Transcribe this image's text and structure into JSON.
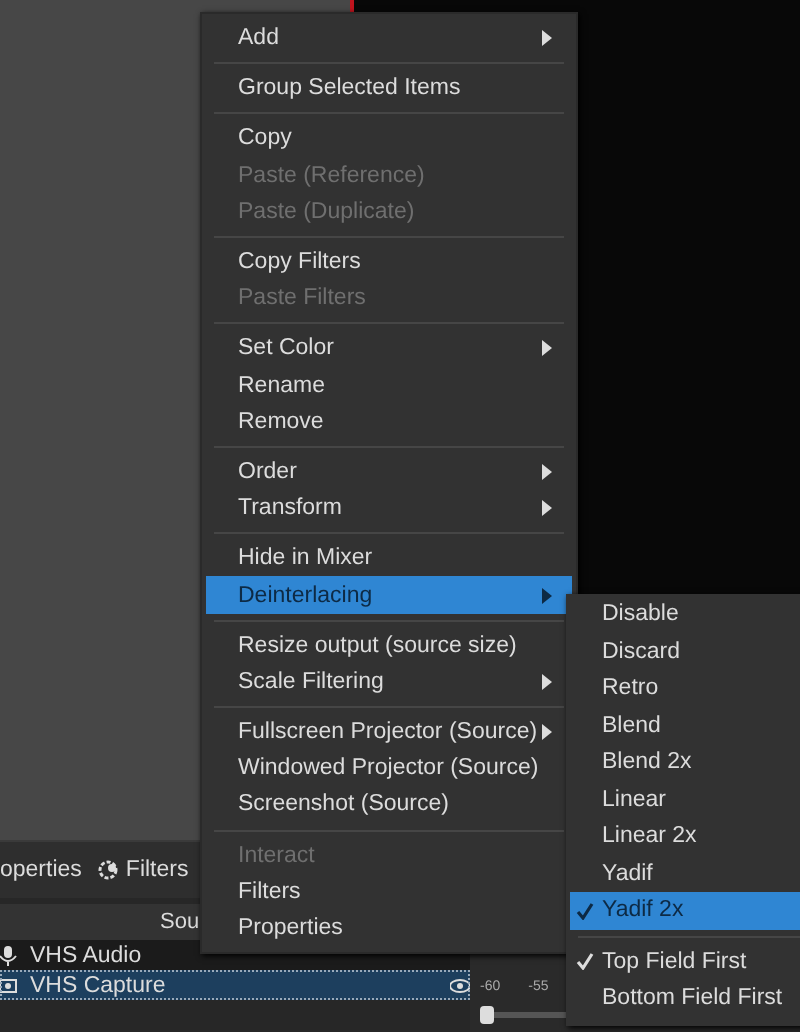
{
  "dock_toolbar": {
    "properties_label": "operties",
    "filters_label": "Filters"
  },
  "sources": {
    "header": "Sou",
    "rows": [
      {
        "name": "VHS Audio",
        "kind": "audio",
        "selected": false
      },
      {
        "name": "VHS Capture",
        "kind": "video",
        "selected": true
      }
    ]
  },
  "mixer": {
    "ticks": [
      "-60",
      "-55"
    ],
    "level": 0.12
  },
  "context_menu": {
    "items": [
      {
        "kind": "item",
        "label": "Add",
        "disabled": false,
        "submenu": true,
        "highlighted": false
      },
      {
        "kind": "separator"
      },
      {
        "kind": "item",
        "label": "Group Selected Items",
        "disabled": false,
        "submenu": false,
        "highlighted": false
      },
      {
        "kind": "separator"
      },
      {
        "kind": "item",
        "label": "Copy",
        "disabled": false,
        "submenu": false,
        "highlighted": false
      },
      {
        "kind": "item",
        "label": "Paste (Reference)",
        "disabled": true,
        "submenu": false,
        "highlighted": false
      },
      {
        "kind": "item",
        "label": "Paste (Duplicate)",
        "disabled": true,
        "submenu": false,
        "highlighted": false
      },
      {
        "kind": "separator"
      },
      {
        "kind": "item",
        "label": "Copy Filters",
        "disabled": false,
        "submenu": false,
        "highlighted": false
      },
      {
        "kind": "item",
        "label": "Paste Filters",
        "disabled": true,
        "submenu": false,
        "highlighted": false
      },
      {
        "kind": "separator"
      },
      {
        "kind": "item",
        "label": "Set Color",
        "disabled": false,
        "submenu": true,
        "highlighted": false
      },
      {
        "kind": "item",
        "label": "Rename",
        "disabled": false,
        "submenu": false,
        "highlighted": false
      },
      {
        "kind": "item",
        "label": "Remove",
        "disabled": false,
        "submenu": false,
        "highlighted": false
      },
      {
        "kind": "separator"
      },
      {
        "kind": "item",
        "label": "Order",
        "disabled": false,
        "submenu": true,
        "highlighted": false
      },
      {
        "kind": "item",
        "label": "Transform",
        "disabled": false,
        "submenu": true,
        "highlighted": false
      },
      {
        "kind": "separator"
      },
      {
        "kind": "item",
        "label": "Hide in Mixer",
        "disabled": false,
        "submenu": false,
        "highlighted": false
      },
      {
        "kind": "item",
        "label": "Deinterlacing",
        "disabled": false,
        "submenu": true,
        "highlighted": true
      },
      {
        "kind": "separator"
      },
      {
        "kind": "item",
        "label": "Resize output (source size)",
        "disabled": false,
        "submenu": false,
        "highlighted": false
      },
      {
        "kind": "item",
        "label": "Scale Filtering",
        "disabled": false,
        "submenu": true,
        "highlighted": false
      },
      {
        "kind": "separator"
      },
      {
        "kind": "item",
        "label": "Fullscreen Projector (Source)",
        "disabled": false,
        "submenu": true,
        "highlighted": false
      },
      {
        "kind": "item",
        "label": "Windowed Projector (Source)",
        "disabled": false,
        "submenu": false,
        "highlighted": false
      },
      {
        "kind": "item",
        "label": "Screenshot (Source)",
        "disabled": false,
        "submenu": false,
        "highlighted": false
      },
      {
        "kind": "separator"
      },
      {
        "kind": "item",
        "label": "Interact",
        "disabled": true,
        "submenu": false,
        "highlighted": false
      },
      {
        "kind": "item",
        "label": "Filters",
        "disabled": false,
        "submenu": false,
        "highlighted": false
      },
      {
        "kind": "item",
        "label": "Properties",
        "disabled": false,
        "submenu": false,
        "highlighted": false
      }
    ]
  },
  "deinterlacing_submenu": {
    "items": [
      {
        "kind": "item",
        "label": "Disable",
        "checked": false,
        "selected": false
      },
      {
        "kind": "item",
        "label": "Discard",
        "checked": false,
        "selected": false
      },
      {
        "kind": "item",
        "label": "Retro",
        "checked": false,
        "selected": false
      },
      {
        "kind": "item",
        "label": "Blend",
        "checked": false,
        "selected": false
      },
      {
        "kind": "item",
        "label": "Blend 2x",
        "checked": false,
        "selected": false
      },
      {
        "kind": "item",
        "label": "Linear",
        "checked": false,
        "selected": false
      },
      {
        "kind": "item",
        "label": "Linear 2x",
        "checked": false,
        "selected": false
      },
      {
        "kind": "item",
        "label": "Yadif",
        "checked": false,
        "selected": false
      },
      {
        "kind": "item",
        "label": "Yadif 2x",
        "checked": true,
        "selected": true
      },
      {
        "kind": "separator"
      },
      {
        "kind": "item",
        "label": "Top Field First",
        "checked": true,
        "selected": false
      },
      {
        "kind": "item",
        "label": "Bottom Field First",
        "checked": false,
        "selected": false
      }
    ]
  }
}
